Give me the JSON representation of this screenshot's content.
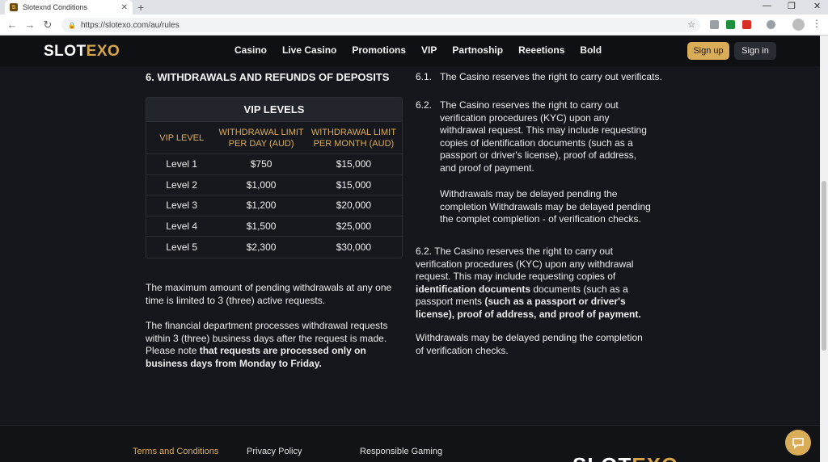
{
  "browser": {
    "tab_title": "Slotexnd Conditions",
    "tab_favicon": "S",
    "tab_close": "✕",
    "new_tab": "+",
    "url": "https://slotexo.com/au/rules",
    "window_controls": [
      "—",
      "❐",
      "✕"
    ]
  },
  "site": {
    "logo_part1": "SLOT",
    "logo_part2": "EXO",
    "nav": [
      "Casino",
      "Live Casino",
      "Promotions",
      "VIP",
      "Partnoship",
      "Reeetions",
      "Bold"
    ],
    "signup_label": "Sign up",
    "signin_label": "Sign in",
    "accent_color": "#d9ac58"
  },
  "section": {
    "title": "6. WITHDRAWALS AND REFUNDS OF DEPOSITS"
  },
  "vip_table": {
    "title": "VIP LEVELS",
    "headers": [
      "VIP LEVEL",
      "WITHDRAWAL LIMIT PER DAY (AUD)",
      "WITHDRAWAL LIMIT PER MONTH (AUD)"
    ],
    "rows": [
      [
        "Level 1",
        "$750",
        "$15,000"
      ],
      [
        "Level 2",
        "$1,000",
        "$15,000"
      ],
      [
        "Level 3",
        "$1,200",
        "$20,000"
      ],
      [
        "Level 4",
        "$1,500",
        "$25,000"
      ],
      [
        "Level 5",
        "$2,300",
        "$30,000"
      ]
    ]
  },
  "left_paragraphs": {
    "p1": "The maximum amount of pending withdrawals at any one time is limited to 3 (three) active requests.",
    "p2_normal": "The financial department processes withdrawal requests within 3 (three) business days after the request is made. Please note",
    "p2_bold": "that requests are processed only on business days from Monday to Friday."
  },
  "right": {
    "n1": "6.1.",
    "t1": "The Casino reserves the right to carry out verificats.",
    "n2": "6.2.",
    "t2": "The Casino reserves the right to carry out verification procedures (KYC) upon any withdrawal request. This may include requesting copies of identification documents (such as a passport or driver's license), proof of address, and proof of payment.",
    "t3": "Withdrawals may be delayed pending the completion Withdrawals may be delayed pending the complet completion - of verification checks.",
    "t4_normal": "6.2. The Casino reserves the right to carry out verification procedures (KYC) upon any withdrawal request. This may include requesting copies of ",
    "t4_bold1": "identification documents",
    "t4_normal2": " documents (such as a passport ments ",
    "t4_bold2": "(such as a passport or driver's license), proof of address, and proof of payment.",
    "t5": "Withdrawals may be delayed pending the completion of verification checks."
  },
  "footer": {
    "links": [
      "Terms and Conditions",
      "Privacy Policy",
      "Responsible Gaming"
    ],
    "logo_part1": "SLOT",
    "logo_part2": "EXO"
  }
}
